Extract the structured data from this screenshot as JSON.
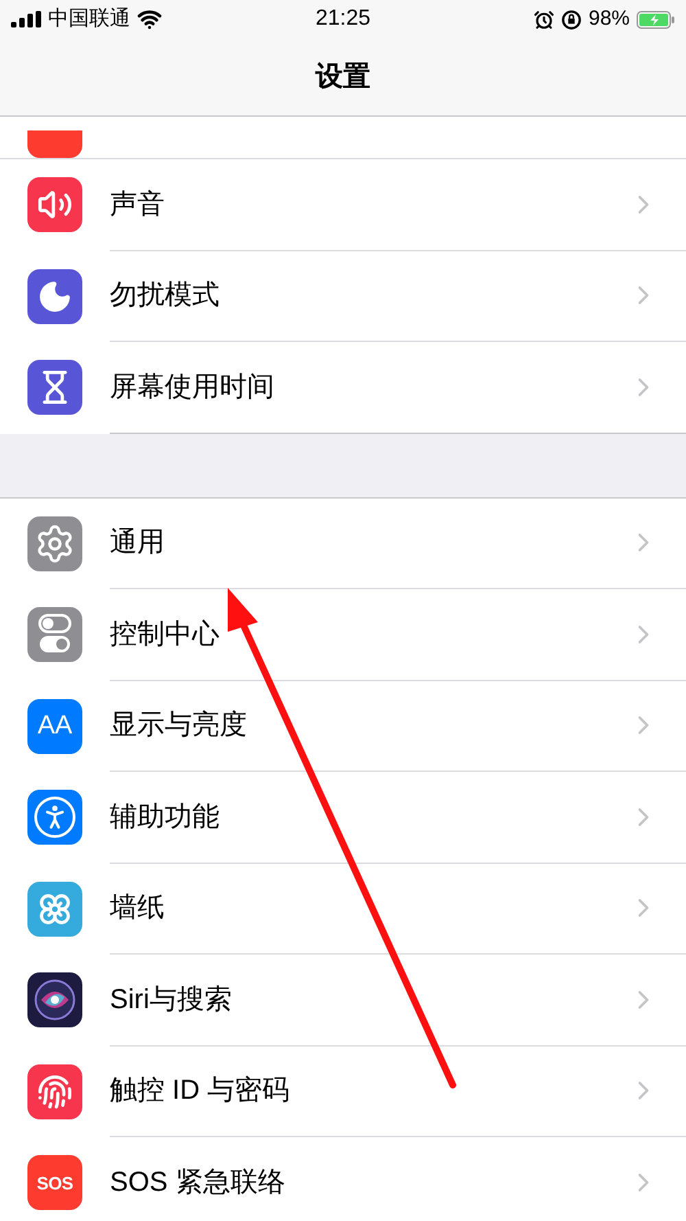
{
  "status_bar": {
    "carrier": "中国联通",
    "time": "21:25",
    "battery": "98%"
  },
  "nav": {
    "title": "设置"
  },
  "groups": [
    {
      "items": [
        {
          "label": "声音",
          "kind": "sound",
          "color": "#f7354c"
        },
        {
          "label": "勿扰模式",
          "kind": "moon",
          "color": "#5856d6"
        },
        {
          "label": "屏幕使用时间",
          "kind": "hourglass",
          "color": "#5856d6"
        }
      ]
    },
    {
      "items": [
        {
          "label": "通用",
          "kind": "gear",
          "color": "#8e8e93"
        },
        {
          "label": "控制中心",
          "kind": "toggles",
          "color": "#8e8e93"
        },
        {
          "label": "显示与亮度",
          "kind": "text",
          "icon_text": "AA",
          "color": "#007aff"
        },
        {
          "label": "辅助功能",
          "kind": "accessibility",
          "color": "#007aff"
        },
        {
          "label": "墙纸",
          "kind": "flower",
          "color": "#35aadc"
        },
        {
          "label": "Siri与搜索",
          "kind": "siri",
          "color": "#1d1b3f"
        },
        {
          "label": "触控 ID 与密码",
          "kind": "fingerprint",
          "color": "#f7354c"
        },
        {
          "label": "SOS 紧急联络",
          "kind": "text",
          "icon_text": "SOS",
          "color": "#fd3b2f"
        }
      ]
    }
  ]
}
